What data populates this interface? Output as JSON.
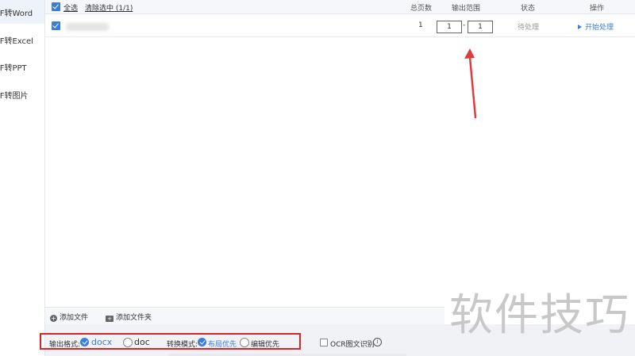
{
  "sidebar": {
    "items": [
      {
        "label": "DF转Word"
      },
      {
        "label": "DF转Excel"
      },
      {
        "label": "DF转PPT"
      },
      {
        "label": "DF转图片"
      }
    ]
  },
  "header": {
    "select_all": "全选",
    "clear_selection": "清除选中 (1/1)",
    "col_pages": "总页数",
    "col_range": "输出范围",
    "col_status": "状态",
    "col_action": "操作"
  },
  "row": {
    "pages": "1",
    "range_from": "1",
    "range_sep": "-",
    "range_to": "1",
    "status": "待处理",
    "action": "开始处理"
  },
  "footer": {
    "add_file": "添加文件",
    "add_folder": "添加文件夹",
    "output_format_label": "输出格式:",
    "format_docx": "docx",
    "format_doc": "doc",
    "mode_label": "转换模式:",
    "mode_layout": "布局优先",
    "mode_edit": "编辑优先",
    "ocr": "OCR图文识别"
  },
  "watermark": "软件技巧",
  "colors": {
    "accent": "#3b7ddc",
    "highlight_box": "#d9242b",
    "arrow": "#e23b3b"
  }
}
